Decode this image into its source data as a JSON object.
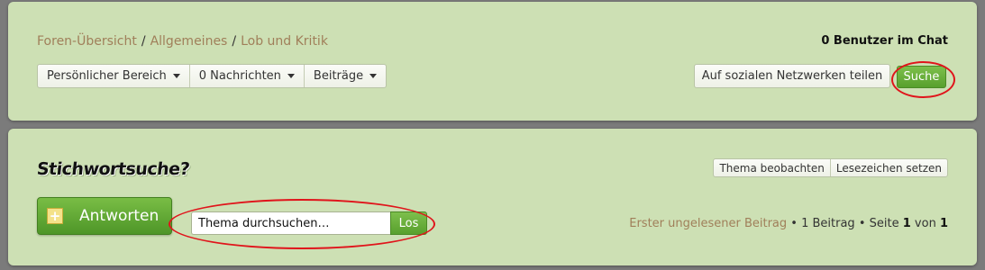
{
  "breadcrumb": {
    "items": [
      "Foren-Übersicht",
      "Allgemeines",
      "Lob und Kritik"
    ],
    "separator": "/"
  },
  "chat": {
    "users_text": "0 Benutzer im Chat"
  },
  "nav_menu": {
    "items": [
      {
        "label": "Persönlicher Bereich",
        "icon": "chevron-down-icon"
      },
      {
        "label": "0 Nachrichten",
        "icon": "chevron-down-icon"
      },
      {
        "label": "Beiträge",
        "icon": "chevron-down-icon"
      }
    ]
  },
  "toolbar": {
    "share_label": "Auf sozialen Netzwerken teilen",
    "search_label": "Suche"
  },
  "topic": {
    "heading": "Stichwortsuche?",
    "watch_label": "Thema beobachten",
    "bookmark_label": "Lesezeichen setzen",
    "reply_label": "Antworten",
    "reply_icon": "plus-icon",
    "search_value": "Thema durchsuchen…",
    "search_go_label": "Los"
  },
  "pagination": {
    "first_unread": "Erster ungelesener Beitrag",
    "post_count_text": "• 1 Beitrag • Seite",
    "current_page": "1",
    "of_text": "von",
    "total_pages": "1"
  },
  "colors": {
    "panel_bg": "#cde0b4",
    "link": "#a07f5a",
    "accent_green": "#58a02d",
    "annotation_red": "#e0141b"
  }
}
